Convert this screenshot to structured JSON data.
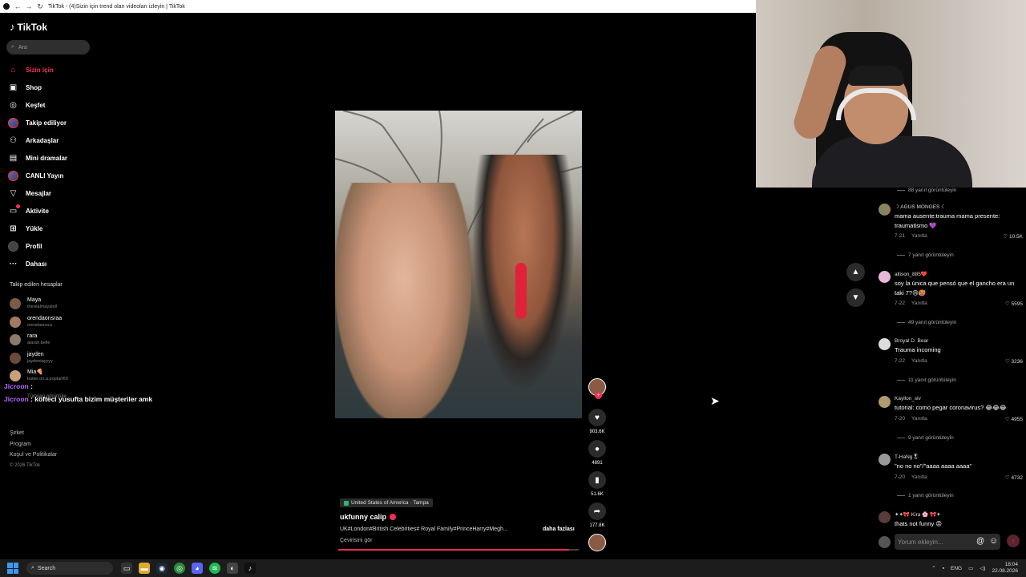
{
  "browser": {
    "title": "TikTok - (4)Sizin için trend olan videoları izleyin | TikTok"
  },
  "sidebar": {
    "logo": "TikTok",
    "search_placeholder": "Ara",
    "nav": [
      {
        "label": "Sizin için",
        "icon": "home-icon",
        "glyph": "⌂",
        "active": true
      },
      {
        "label": "Shop",
        "icon": "shop-icon",
        "glyph": "▣"
      },
      {
        "label": "Keşfet",
        "icon": "compass-icon",
        "glyph": "◎"
      },
      {
        "label": "Takip ediliyor",
        "icon": "following-avatar-icon",
        "glyph": ""
      },
      {
        "label": "Arkadaşlar",
        "icon": "friends-icon",
        "glyph": "⚇"
      },
      {
        "label": "Mini dramalar",
        "icon": "drama-icon",
        "glyph": "▤"
      },
      {
        "label": "CANLI Yayın",
        "icon": "live-avatar-icon",
        "glyph": ""
      },
      {
        "label": "Mesajlar",
        "icon": "messages-icon",
        "glyph": "▽"
      },
      {
        "label": "Aktivite",
        "icon": "activity-icon",
        "glyph": "▭"
      },
      {
        "label": "Yükle",
        "icon": "upload-icon",
        "glyph": "⊞"
      },
      {
        "label": "Profil",
        "icon": "profile-avatar-icon",
        "glyph": ""
      },
      {
        "label": "Dahası",
        "icon": "more-icon",
        "glyph": "···"
      }
    ],
    "following_title": "Takip edilen hesaplar",
    "following": [
      {
        "name": "Maya",
        "handle": "therealmayahill"
      },
      {
        "name": "orendaonsraa",
        "handle": "orendaonsra"
      },
      {
        "name": "rara",
        "handle": "alarah.belle"
      },
      {
        "name": "jayden",
        "handle": "jaydentayyyy"
      },
      {
        "name": "Mia🍕",
        "handle": "butter.on.a.poptart69"
      }
    ],
    "chat": [
      {
        "user": "Jicroon",
        "text": " : "
      },
      {
        "user": "Jicroon",
        "text": " : köfteci yusufta bizim müşteriler amk",
        "seen": "Tümünü görüntüle"
      }
    ],
    "footer": [
      "Şirket",
      "Program",
      "Koşul ve Politikalar"
    ],
    "copyright": "© 2026 TikTok"
  },
  "video": {
    "location": "United States of America · Tampa",
    "author": "ukfunny calip",
    "caption": "UK#London#British Celebrities# Royal Family#PrinceHarry#Megh...",
    "more": "daha fazlası",
    "translate": "Çevirisini gör",
    "progress": 0.96,
    "likes": "903.6K",
    "comments": "4891",
    "saves": "51.6K",
    "shares": "177.8K"
  },
  "comments": {
    "top_more": "88 yanıt görüntüleyin",
    "reply_label": "Yanıtla",
    "items": [
      {
        "user": "☽ AGUS MONGES ☾",
        "text": "mama ausente:trauma mama presente: traumatismo 💜",
        "date": "7-21",
        "likes": "10.5K",
        "more": "7 yanıt görüntüleyin"
      },
      {
        "user": "allison_885❤️",
        "text": "soy la única que pensó que el gancho era un taki 7?😢🥵",
        "date": "7-22",
        "likes": "5595",
        "more": "49 yanıt görüntüleyin"
      },
      {
        "user": "Broyal D. Bear",
        "text": "Trauma incoming",
        "date": "7-22",
        "likes": "3236",
        "more": "11 yanıt görüntüleyin"
      },
      {
        "user": "Kayllon_slv",
        "text": "tutorial: como pegar coronavirus? 😂😂😂",
        "date": "7-20",
        "likes": "4955",
        "more": "9 yanıt görüntüleyin"
      },
      {
        "user": "T-HaNg🎖",
        "text": "\"no no no\"/\"aaaa aaaa aaaa\"",
        "date": "7-20",
        "likes": "4732",
        "more": "1 yanıt görüntüleyin"
      },
      {
        "user": "✦✦🎀 Kira 🌸 🎀✦",
        "text": "thats not funny 😡",
        "date": "",
        "likes": "",
        "more": ""
      }
    ],
    "composer_placeholder": "Yorum ekleyin..."
  },
  "taskbar": {
    "search": "Search",
    "lang": "ENG",
    "time": "18:04",
    "date": "22.08.2026"
  }
}
